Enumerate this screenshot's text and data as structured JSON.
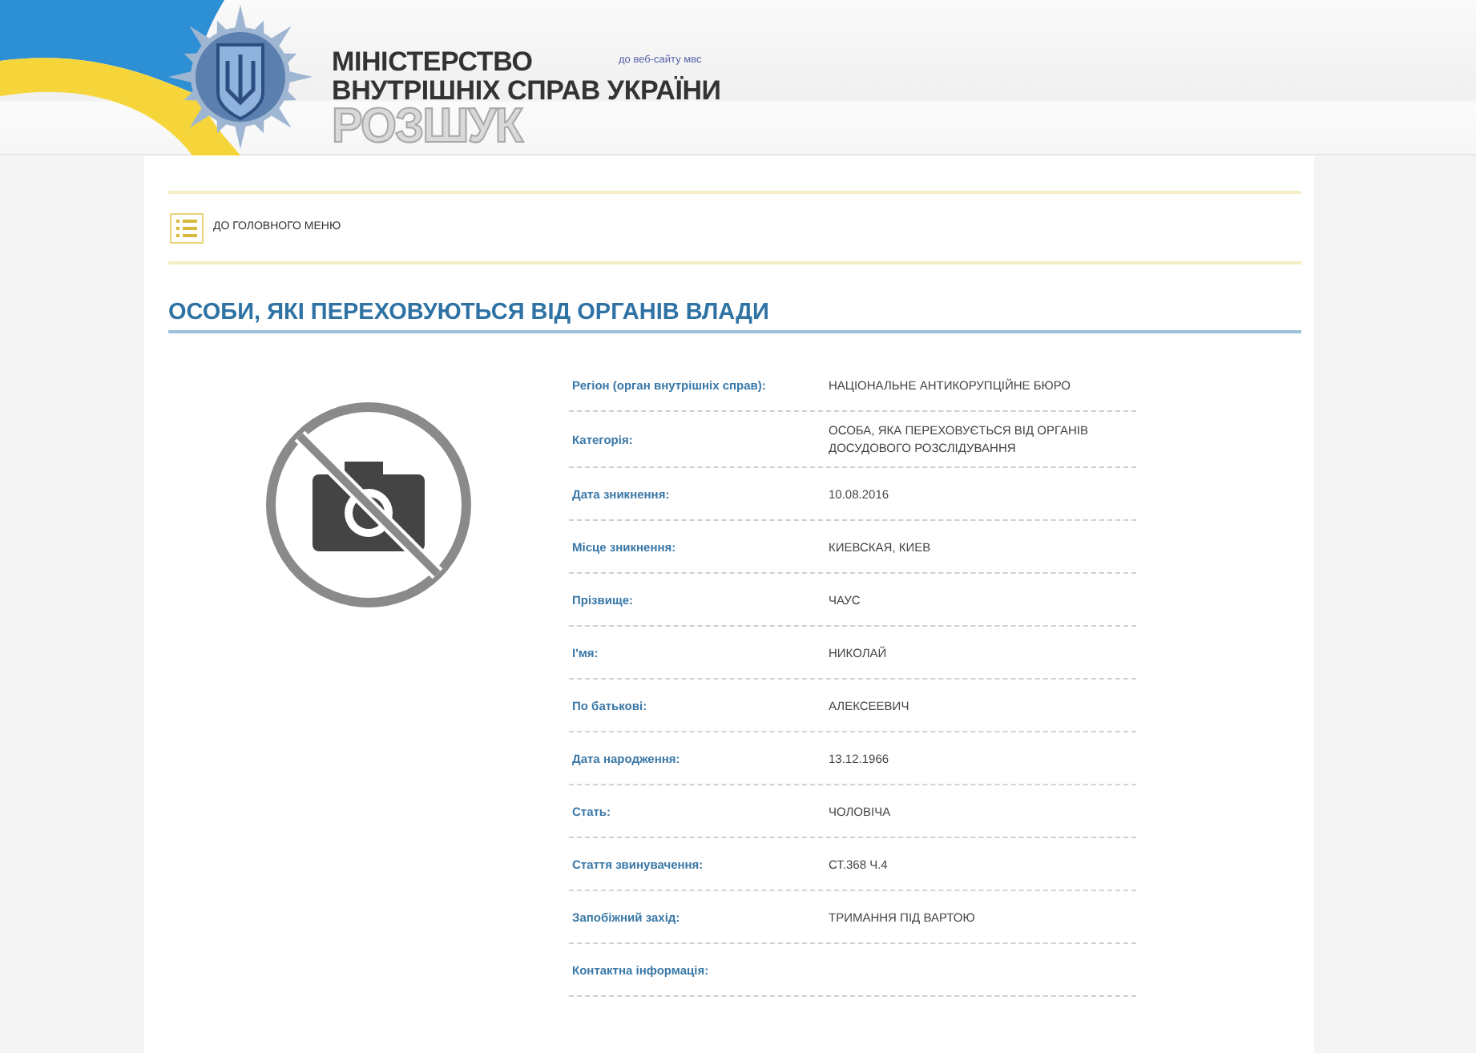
{
  "header": {
    "ministry_line_1": "МІНІСТЕРСТВО",
    "ministry_line_2": "ВНУТРІШНІХ СПРАВ УКРАЇНИ",
    "site_link": "до веб-сайту мвс",
    "section_title": "РОЗШУК"
  },
  "menu_link": "ДО ГОЛОВНОГО МЕНЮ",
  "page_title": "ОСОБИ, ЯКІ ПЕРЕХОВУЮТЬСЯ ВІД ОРГАНІВ ВЛАДИ",
  "photo": {
    "kind": "no-photo"
  },
  "details": [
    {
      "label": "Регіон (орган внутрішніх справ):",
      "value": "НАЦІОНАЛЬНЕ АНТИКОРУПЦІЙНЕ БЮРО"
    },
    {
      "label": "Категорія:",
      "value": "ОСОБА, ЯКА ПЕРЕХОВУЄТЬСЯ ВІД ОРГАНІВ ДОСУДОВОГО РОЗСЛІДУВАННЯ"
    },
    {
      "label": "Дата зникнення:",
      "value": "10.08.2016"
    },
    {
      "label": "Місце зникнення:",
      "value": "КИЕВСКАЯ, КИЕВ"
    },
    {
      "label": "Прізвище:",
      "value": "ЧАУС"
    },
    {
      "label": "І'мя:",
      "value": "НИКОЛАЙ"
    },
    {
      "label": "По батькові:",
      "value": "АЛЕКСЕЕВИЧ"
    },
    {
      "label": "Дата народження:",
      "value": "13.12.1966"
    },
    {
      "label": "Стать:",
      "value": "ЧОЛОВІЧА"
    },
    {
      "label": "Стаття звинувачення:",
      "value": "СТ.368 Ч.4"
    },
    {
      "label": "Запобіжний захід:",
      "value": "ТРИМАННЯ ПІД ВАРТОЮ"
    },
    {
      "label": "Контактна інформація:"
    }
  ]
}
